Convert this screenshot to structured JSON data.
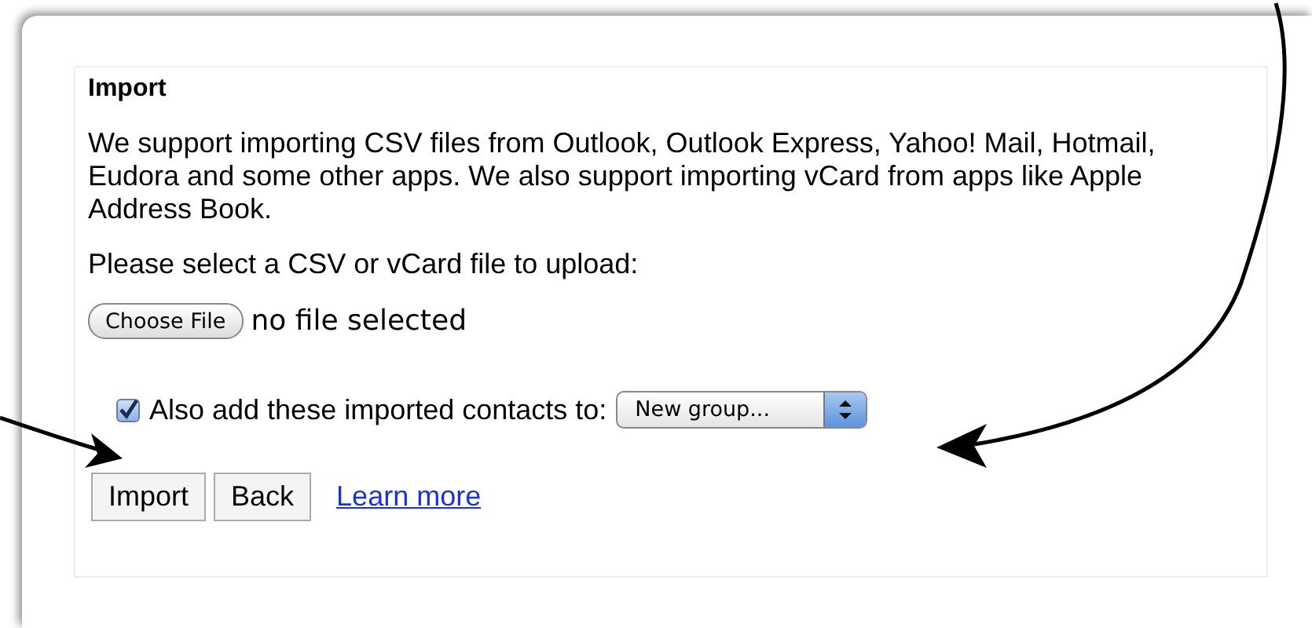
{
  "panel": {
    "title": "Import",
    "description": "We support importing CSV files from Outlook, Outlook Express, Yahoo! Mail, Hotmail, Eudora and some other apps. We also support importing vCard from apps like Apple Address Book.",
    "prompt": "Please select a CSV or vCard file to upload:",
    "file_button": "Choose File",
    "file_status": "no file selected",
    "group_option": {
      "label": "Also add these imported contacts to:",
      "checked": true
    },
    "group_select": {
      "value": "New group..."
    },
    "buttons": [
      "Import",
      "Back"
    ],
    "link": "Learn more"
  }
}
